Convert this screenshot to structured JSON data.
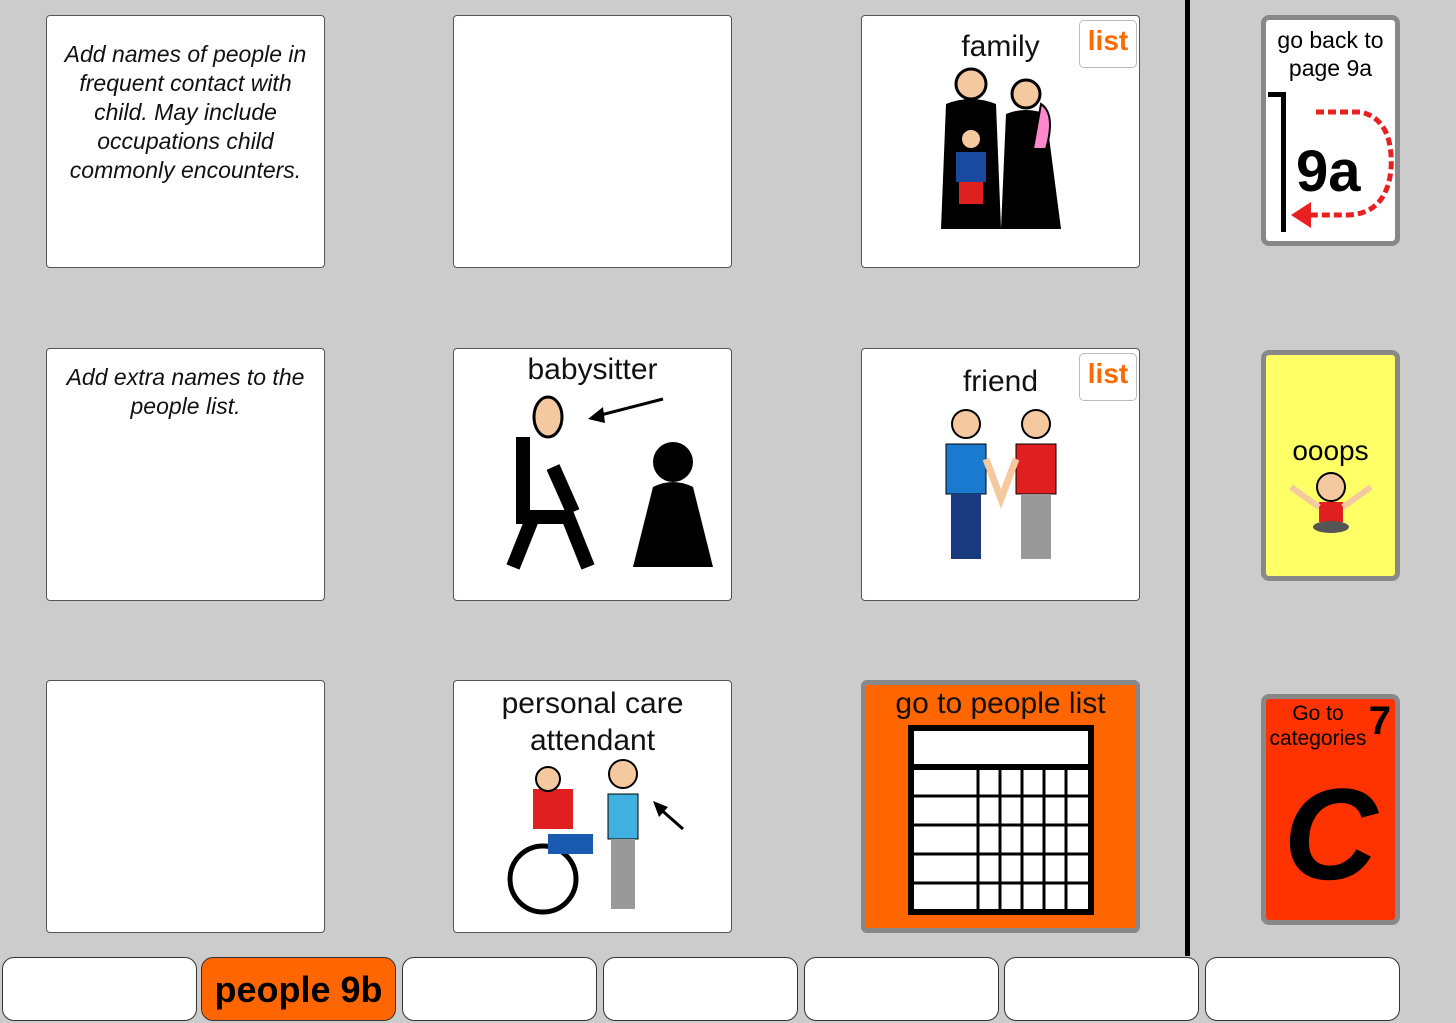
{
  "grid": {
    "note1": "Add names of people in frequent contact with child. May include occupations child commonly encounters.",
    "note2": "Add extra names to the people list.",
    "family": {
      "label": "family",
      "badge": "list"
    },
    "babysitter": {
      "label": "babysitter"
    },
    "friend": {
      "label": "friend",
      "badge": "list"
    },
    "attendant": {
      "label": "personal care attendant"
    },
    "people_list": {
      "label": "go to people list"
    }
  },
  "side": {
    "back": {
      "label": "go back to page 9a",
      "big": "9a"
    },
    "ooops": {
      "label": "ooops"
    },
    "categories": {
      "label": "Go to categories",
      "number": "7",
      "big": "C"
    }
  },
  "tabs": [
    "",
    "people 9b",
    "",
    "",
    "",
    "",
    ""
  ],
  "colors": {
    "orange": "#ff6600",
    "red": "#ff3300",
    "yellow": "#ffff66"
  }
}
